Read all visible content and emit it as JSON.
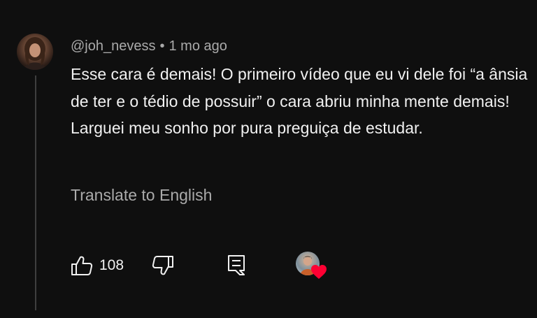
{
  "comment": {
    "author": "@joh_nevess",
    "separator": "•",
    "time": "1 mo ago",
    "text": "Esse cara é demais! O primeiro vídeo que eu vi dele foi “a ânsia de ter e o tédio de possuir” o cara abriu minha mente demais! Larguei meu sonho por pura preguiça de estudar.",
    "translate_label": "Translate to English"
  },
  "actions": {
    "like_count": "108"
  },
  "icons": {
    "like": "thumbs-up-icon",
    "dislike": "thumbs-down-icon",
    "reply": "comment-icon",
    "creator_heart": "heart-icon"
  },
  "colors": {
    "background": "#0f0f0f",
    "text_primary": "#f1f1f1",
    "text_secondary": "#aaaaaa",
    "heart": "#ff0033"
  }
}
